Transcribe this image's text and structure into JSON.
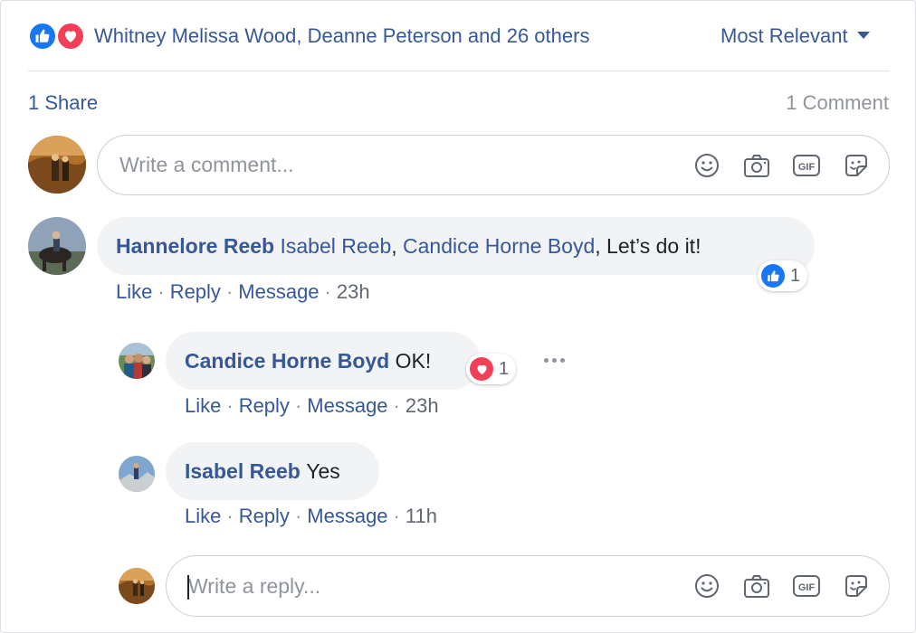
{
  "reactions": {
    "icons": [
      "like-icon",
      "love-icon"
    ],
    "summary": "Whitney Melissa Wood, Deanne Peterson and 26 others",
    "sort_label": "Most Relevant"
  },
  "stats": {
    "shares": "1 Share",
    "comments": "1 Comment"
  },
  "comment_input": {
    "placeholder": "Write a comment...",
    "value": ""
  },
  "input_tools": [
    "emoji-icon",
    "camera-icon",
    "gif-icon",
    "sticker-icon"
  ],
  "comments": [
    {
      "author": "Hannelore Reeb",
      "tag1": "Isabel Reeb",
      "sep1": ",",
      "tag2": "Candice Horne Boyd",
      "text": ", Let’s do it!",
      "reaction": {
        "icon": "like-icon",
        "count": "1"
      },
      "actions": {
        "like": "Like",
        "reply": "Reply",
        "message": "Message",
        "time": "23h"
      }
    }
  ],
  "replies": [
    {
      "author": "Candice Horne Boyd",
      "text": "OK!",
      "reaction": {
        "icon": "love-icon",
        "count": "1"
      },
      "actions": {
        "like": "Like",
        "reply": "Reply",
        "message": "Message",
        "time": "23h"
      }
    },
    {
      "author": "Isabel Reeb",
      "text": "Yes",
      "actions": {
        "like": "Like",
        "reply": "Reply",
        "message": "Message",
        "time": "11h"
      }
    }
  ],
  "separator": "·",
  "reply_input": {
    "placeholder": "Write a reply...",
    "value": ""
  },
  "colors": {
    "link": "#365899",
    "like": "#1877f2",
    "love": "#f33e58",
    "bubble": "#f2f3f5"
  }
}
